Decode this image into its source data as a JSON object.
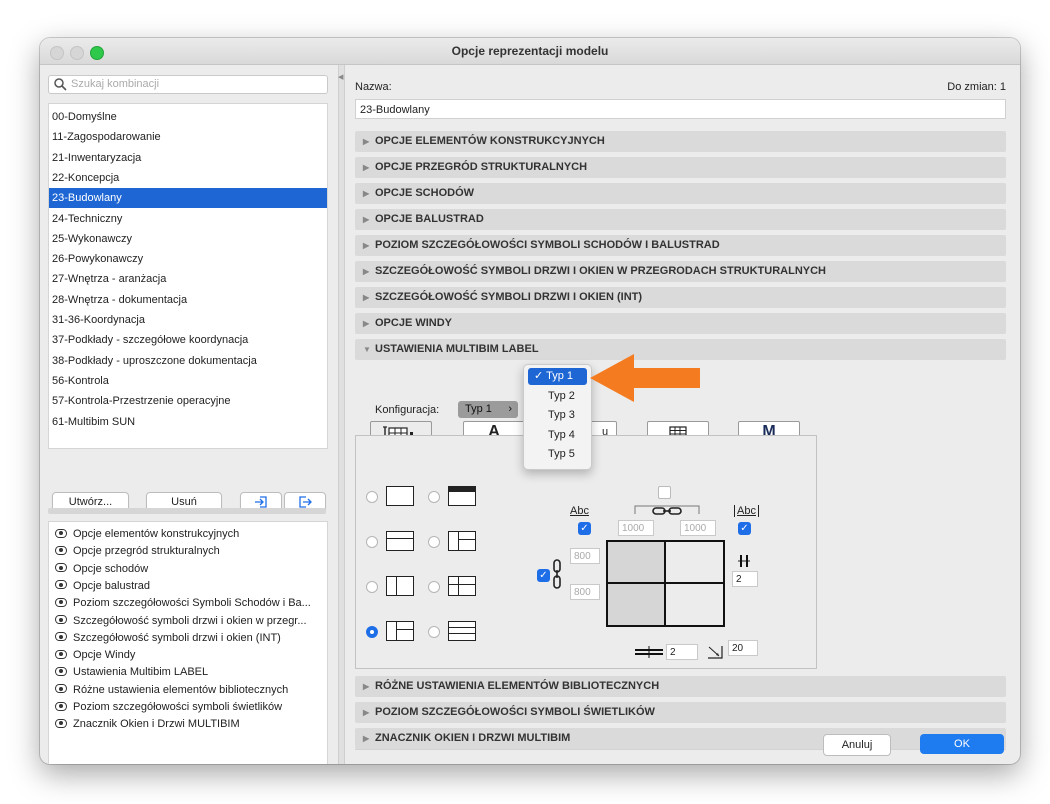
{
  "window": {
    "title": "Opcje reprezentacji modelu"
  },
  "left": {
    "search_placeholder": "Szukaj kombinacji",
    "combinations": [
      "00-Domyślne",
      "11-Zagospodarowanie",
      "21-Inwentaryzacja",
      "22-Koncepcja",
      "23-Budowlany",
      "24-Techniczny",
      "25-Wykonawczy",
      "26-Powykonawczy",
      "27-Wnętrza - aranżacja",
      "28-Wnętrza - dokumentacja",
      "31-36-Koordynacja",
      "37-Podkłady - szczegółowe koordynacja",
      "38-Podkłady - uproszczone dokumentacja",
      "56-Kontrola",
      "57-Kontrola-Przestrzenie operacyjne",
      "61-Multibim SUN"
    ],
    "selected_index": 4,
    "create_label": "Utwórz...",
    "delete_label": "Usuń",
    "options": [
      "Opcje elementów konstrukcyjnych",
      "Opcje przegród strukturalnych",
      "Opcje schodów",
      "Opcje balustrad",
      "Poziom szczegółowości Symboli Schodów i Ba...",
      "Szczegółowość symboli drzwi i okien w przegr...",
      "Szczegółowość symboli drzwi i okien (INT)",
      "Opcje Windy",
      "Ustawienia Multibim LABEL",
      "Różne ustawienia elementów bibliotecznych",
      "Poziom szczegółowości symboli świetlików",
      "Znacznik Okien i Drzwi MULTIBIM"
    ]
  },
  "right": {
    "name_label": "Nazwa:",
    "changes_label": "Do zmian: 1",
    "name_value": "23-Budowlany",
    "sections": [
      "OPCJE ELEMENTÓW KONSTRUKCYJNYCH",
      "OPCJE PRZEGRÓD STRUKTURALNYCH",
      "OPCJE SCHODÓW",
      "OPCJE BALUSTRAD",
      "POZIOM SZCZEGÓŁOWOŚCI SYMBOLI SCHODÓW I BALUSTRAD",
      "SZCZEGÓŁOWOŚĆ SYMBOLI DRZWI I OKIEN W PRZEGRODACH STRUKTURALNYCH",
      "SZCZEGÓŁOWOŚĆ SYMBOLI DRZWI I OKIEN (INT)",
      "OPCJE WINDY",
      "USTAWIENIA MULTIBIM LABEL"
    ],
    "sections_after": [
      "RÓŻNE USTAWIENIA ELEMENTÓW BIBLIOTECZNYCH",
      "POZIOM SZCZEGÓŁOWOŚCI SYMBOLI ŚWIETLIKÓW",
      "ZNACZNIK OKIEN I DRZWI MULTIBIM"
    ],
    "config_label": "Konfiguracja:",
    "config_value": "Typ 1",
    "menu_items": [
      "Typ 1",
      "Typ 2",
      "Typ 3",
      "Typ 4",
      "Typ 5"
    ],
    "menu_selected_index": 0,
    "tabs": [
      "A",
      "M"
    ],
    "abc_label": "Abc",
    "fields": {
      "top_left": "1000",
      "top_right": "1000",
      "left_top": "800",
      "left_bottom": "800",
      "right": "2",
      "bottom": "2",
      "corner": "20"
    },
    "cancel_label": "Anuluj",
    "ok_label": "OK",
    "accent_color": "#1e66d4",
    "arrow_color": "#f47b20"
  }
}
